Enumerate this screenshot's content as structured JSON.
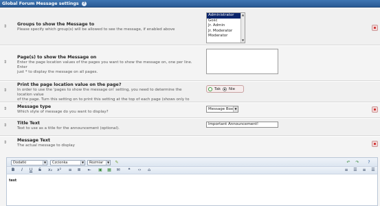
{
  "header": {
    "title": "Global Forum Message settings",
    "help_icon": "help-icon"
  },
  "groups": {
    "title": "Groups to show the Message to",
    "desc": "Please specify which group(s) will be allowed to see the message, if enabled above",
    "options": [
      "Administrator",
      "Gość",
      "Jr. Admin",
      "Jr. Moderator",
      "Moderator"
    ],
    "selected": "Administrator"
  },
  "pages": {
    "title": "Page(s) to show the Message on",
    "desc1": "Enter the page location values of the pages you want to show the message on, one per line. Enter",
    "desc2": "just * to display the message on all pages."
  },
  "print_location": {
    "title": "Print the page location value on the page?",
    "desc1": "In order to use the 'pages to show the message on' setting, you need to determine the location value",
    "desc2": "of the page. Turn this setting on to print this setting at the top of each page (shows only to admins).",
    "yes": "Tak",
    "no": "Nie",
    "selected": "Nie"
  },
  "message_type": {
    "title": "Message type",
    "desc": "Which style of message do you want to display?",
    "value": "Message Box"
  },
  "title_text": {
    "title": "Title Text",
    "desc": "Text to use as a title for the announcement (optional).",
    "value": "Important Announcement!"
  },
  "message_text": {
    "title": "Message Text",
    "desc": "The actual message to display"
  },
  "editor": {
    "style": "Dodatki",
    "font": "Czcionka",
    "size": "Rozmiar",
    "content": "test"
  }
}
